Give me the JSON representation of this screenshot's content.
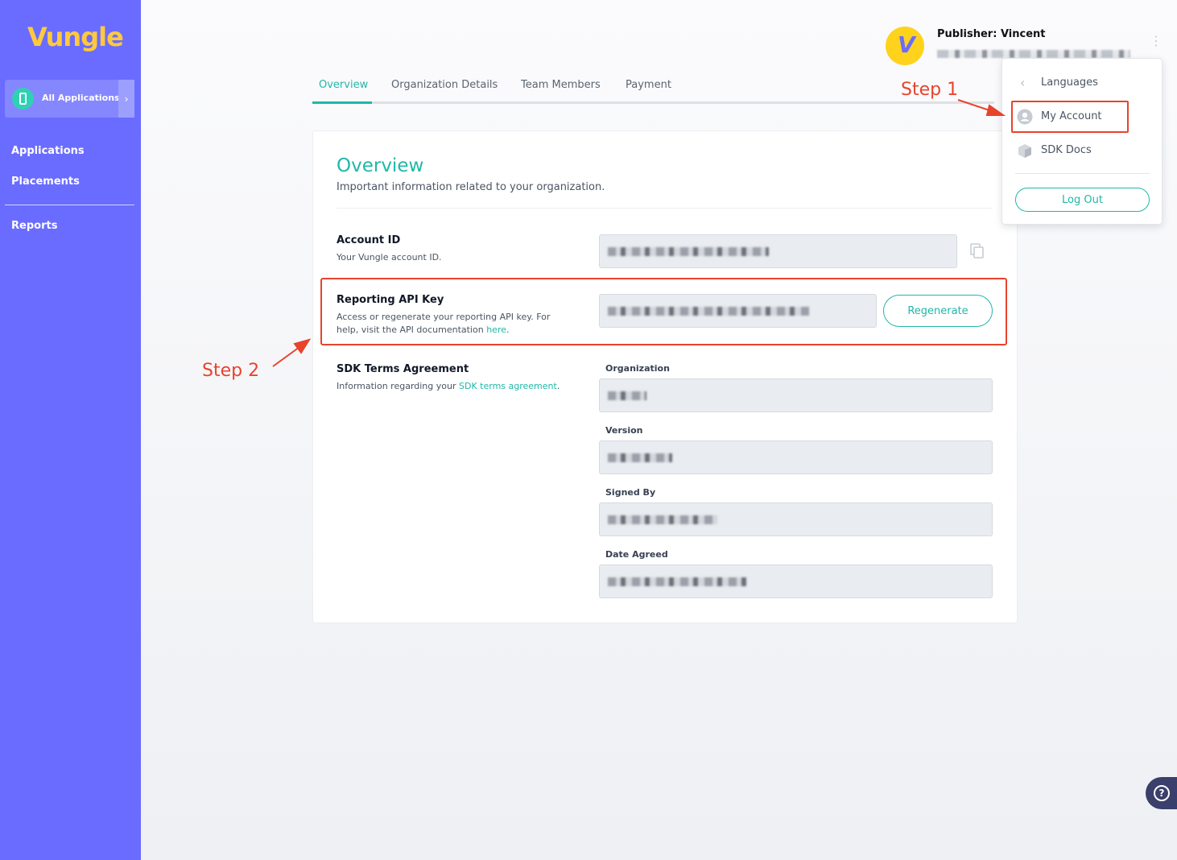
{
  "brand": {
    "logo": "Vungle",
    "accent": "#1fb8a8",
    "sidebar_color": "#6a6cff",
    "annotation_color": "#e8432c"
  },
  "sidebar": {
    "app_switcher": "All Applications",
    "items": [
      {
        "label": "Applications"
      },
      {
        "label": "Placements"
      },
      {
        "label": "Reports"
      }
    ]
  },
  "header": {
    "publisher": "Publisher: Vincent"
  },
  "tabs": [
    {
      "label": "Overview"
    },
    {
      "label": "Organization Details"
    },
    {
      "label": "Team Members"
    },
    {
      "label": "Payment"
    }
  ],
  "overview": {
    "title": "Overview",
    "subtitle": "Important information related to your organization.",
    "account_id": {
      "title": "Account ID",
      "desc": "Your Vungle account ID."
    },
    "api_key": {
      "title": "Reporting API Key",
      "desc": "Access or regenerate your reporting API key. For help, visit the API documentation ",
      "link": "here",
      "button": "Regenerate"
    },
    "sdk_terms": {
      "title": "SDK Terms Agreement",
      "desc": "Information regarding your ",
      "link": "SDK terms agreement",
      "fields": [
        {
          "label": "Organization"
        },
        {
          "label": "Version"
        },
        {
          "label": "Signed By"
        },
        {
          "label": "Date Agreed"
        }
      ]
    }
  },
  "menu": {
    "items": [
      {
        "label": "Languages"
      },
      {
        "label": "My Account"
      },
      {
        "label": "SDK Docs"
      }
    ],
    "logout": "Log Out"
  },
  "annotations": {
    "step1": "Step 1",
    "step2": "Step 2"
  },
  "help": {
    "icon": "?"
  }
}
